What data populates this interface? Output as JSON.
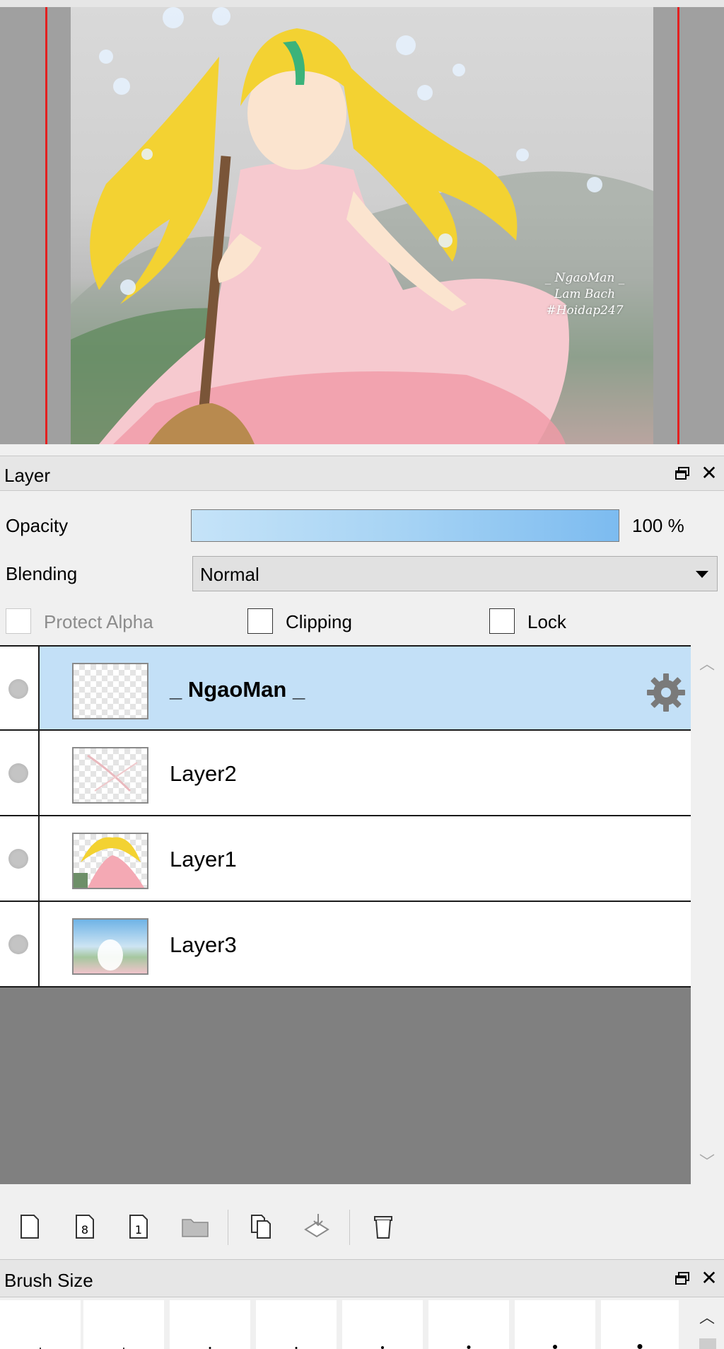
{
  "canvas": {
    "watermark_lines": [
      "_ NgaoMan _",
      "Lam Bach",
      "#Hoidap247"
    ]
  },
  "layer_panel": {
    "title": "Layer",
    "opacity_label": "Opacity",
    "opacity_value": "100 %",
    "opacity_fraction": 1.0,
    "blending_label": "Blending",
    "blending_value": "Normal",
    "protect_alpha_label": "Protect Alpha",
    "clipping_label": "Clipping",
    "lock_label": "Lock",
    "layers": [
      {
        "name": "_ NgaoMan _",
        "selected": true
      },
      {
        "name": "Layer2",
        "selected": false
      },
      {
        "name": "Layer1",
        "selected": false
      },
      {
        "name": "Layer3",
        "selected": false
      }
    ]
  },
  "toolbar": {
    "icons": [
      "new-layer-icon",
      "new-8bit-layer-icon",
      "new-1bit-layer-icon",
      "new-folder-icon",
      "duplicate-layer-icon",
      "merge-down-icon",
      "delete-layer-icon"
    ]
  },
  "brush_panel": {
    "title": "Brush Size"
  },
  "colors": {
    "selection": "#c3e0f7",
    "accent_red": "#e32020",
    "list_background": "#808080"
  }
}
